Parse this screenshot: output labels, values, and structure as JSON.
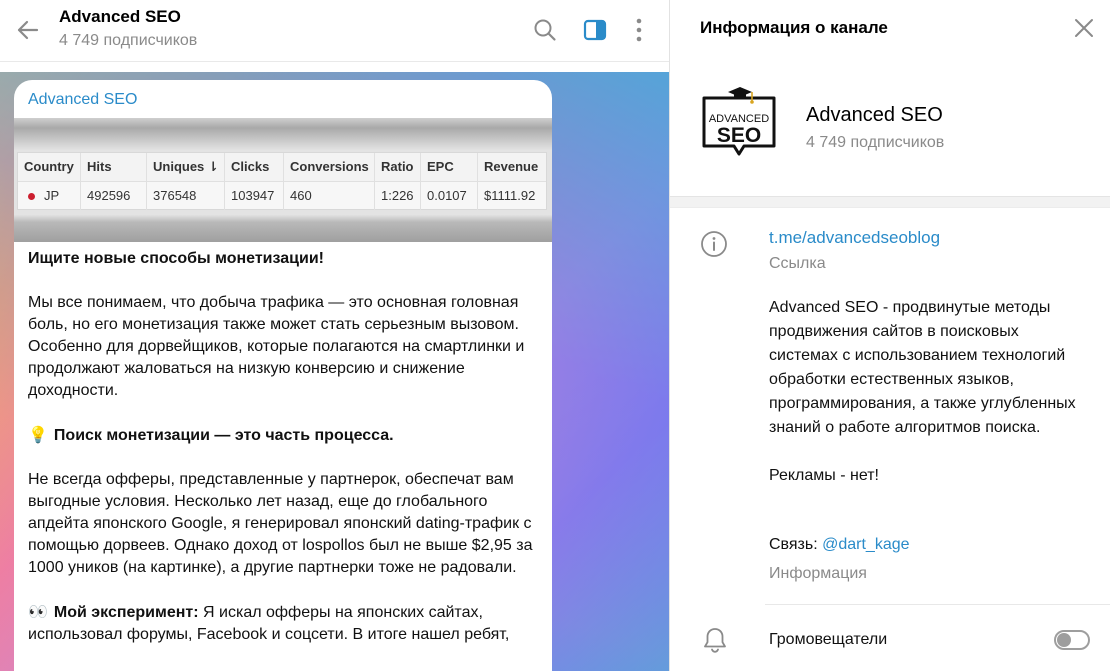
{
  "header": {
    "title": "Advanced SEO",
    "subscribers": "4 749 подписчиков",
    "icons": [
      "back-arrow-icon",
      "search-icon",
      "sidebar-toggle-icon",
      "more-vertical-icon"
    ],
    "accent": "#2a8bc9"
  },
  "message": {
    "author": "Advanced SEO",
    "table": {
      "headers": [
        "Country",
        "Hits",
        "Uniques ⇂",
        "Clicks",
        "Conversions",
        "Ratio",
        "EPC",
        "Revenue"
      ],
      "rows": [
        [
          "JP",
          "492596",
          "376548",
          "103947",
          "460",
          "1:226",
          "0.0107",
          "$1111.92"
        ]
      ]
    },
    "heading": "Ищите новые способы монетизации!",
    "p1": "Мы все понимаем, что добыча трафика — это основная головная боль, но его монетизация также может стать серьезным вызовом. Особенно для дорвейщиков, которые полагаются на смартлинки и продолжают жаловаться на низкую конверсию и снижение доходности.",
    "s2_emoji": "💡",
    "s2_title": "Поиск монетизации — это часть процесса.",
    "p2": "Не всегда офферы, представленные у партнерок, обеспечат вам выгодные условия. Несколько лет назад, еще до глобального апдейта японского Google, я генерировал японский dating-трафик с помощью дорвеев. Однако доход от lospollos был не выше $2,95 за 1000 уников (на картинке), а другие партнерки тоже не радовали.",
    "s3_emoji": "👀",
    "s3_title": "Мой эксперимент:",
    "p3": " Я искал офферы на японских сайтах, использовал форумы, Facebook и соцсети. В итоге нашел ребят,"
  },
  "panel": {
    "title": "Информация о канале",
    "channel_name": "Advanced SEO",
    "subscribers": "4 749 подписчиков",
    "logo_text_top": "ADVANCED",
    "logo_text_bottom": "SEO",
    "link": "t.me/advancedseoblog",
    "link_caption": "Ссылка",
    "description": "Advanced SEO - продвинутые методы продвижения сайтов в поисковых системах с использованием технологий обработки естественных языков, программирования, а также углубленных знаний о работе алгоритмов поиска.",
    "ads": "Рекламы - нет!",
    "contact_label": "Связь: ",
    "contact_handle": "@dart_kage",
    "info_caption": "Информация",
    "broadcasters_label": "Громовещатели",
    "broadcasters_enabled": false
  }
}
